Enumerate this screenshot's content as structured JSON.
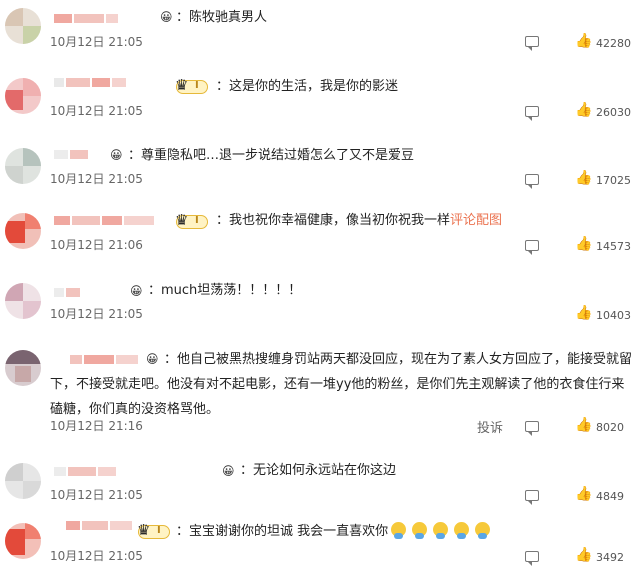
{
  "comments": [
    {
      "text": "：陈牧驰真男人",
      "time": "10月12日 21:05",
      "likes": "42280"
    },
    {
      "text": "：这是你的生活，我是你的影迷",
      "time": "10月12日 21:05",
      "likes": "26030"
    },
    {
      "text": "：尊重隐私吧…退一步说结过婚怎么了又不是爱豆",
      "time": "10月12日 21:05",
      "likes": "17025"
    },
    {
      "text": "：我也祝你幸福健康，像当初你祝我一样",
      "link": "评论配图",
      "time": "10月12日 21:06",
      "likes": "14573"
    },
    {
      "text": "：much坦荡荡！！！！！",
      "time": "10月12日 21:05",
      "likes": "10403"
    },
    {
      "text": "：他自己被黑热搜缠身罚站两天都没回应，现在为了素人女方回应了，能接受就留下，不接受就走吧。他没有对不起电影，还有一堆yy他的粉丝，是你们先主观解读了他的衣食住行来磕糖，你们真的没资格骂他。",
      "time": "10月12日 21:16",
      "likes": "8020",
      "report": "投诉"
    },
    {
      "text": "：无论如何永远站在你这边",
      "time": "10月12日 21:05",
      "likes": "4849"
    },
    {
      "text": "：宝宝谢谢你的坦诚 我会一直喜欢你",
      "time": "10月12日 21:05",
      "likes": "3492"
    }
  ],
  "icons": {
    "reply": "comment-icon",
    "like": "thumbs-up-icon",
    "badge": "crown-vip-icon",
    "emoji": "smile-emoji-icon"
  }
}
